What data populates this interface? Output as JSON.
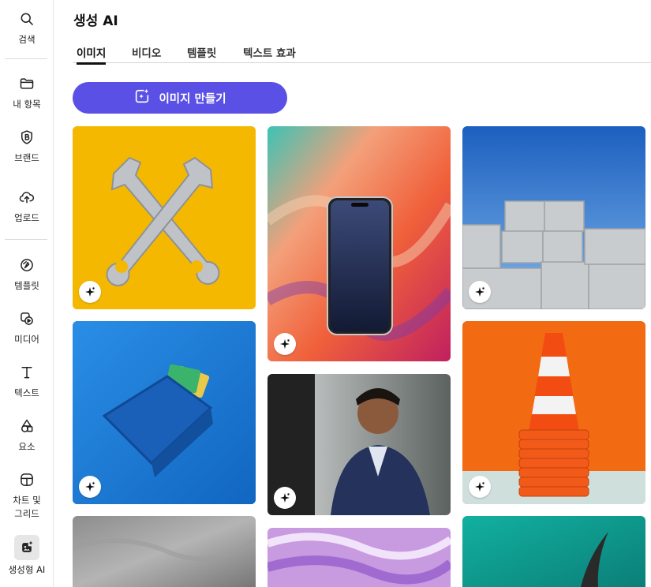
{
  "sidebar": {
    "items": [
      {
        "label": "검색",
        "icon": "search-icon"
      },
      {
        "label": "내 항목",
        "icon": "folder-icon"
      },
      {
        "label": "브랜드",
        "icon": "brand-icon"
      },
      {
        "label": "업로드",
        "icon": "upload-icon"
      },
      {
        "label": "템플릿",
        "icon": "template-icon"
      },
      {
        "label": "미디어",
        "icon": "media-icon"
      },
      {
        "label": "텍스트",
        "icon": "text-icon"
      },
      {
        "label": "요소",
        "icon": "elements-icon"
      },
      {
        "label": "차트 및\n그리드",
        "icon": "chart-grid-icon"
      },
      {
        "label": "생성형 AI",
        "icon": "generative-ai-icon"
      }
    ]
  },
  "header": {
    "title": "생성 AI",
    "tabs": [
      {
        "label": "이미지",
        "active": true
      },
      {
        "label": "비디오",
        "active": false
      },
      {
        "label": "템플릿",
        "active": false
      },
      {
        "label": "텍스트 효과",
        "active": false
      }
    ]
  },
  "create_button": {
    "label": "이미지 만들기",
    "icon": "sparkle-image-icon",
    "color": "#5a50e6"
  },
  "gallery": {
    "badge_icon": "sparkle-icon",
    "tiles": [
      {
        "name": "wrenches-yellow"
      },
      {
        "name": "phone-swirl"
      },
      {
        "name": "concrete-blocks-sky"
      },
      {
        "name": "blue-wallet"
      },
      {
        "name": "businessman-smiling"
      },
      {
        "name": "traffic-cone-orange"
      },
      {
        "name": "gray-paper-texture"
      },
      {
        "name": "purple-marble"
      },
      {
        "name": "feather-teal"
      }
    ]
  }
}
